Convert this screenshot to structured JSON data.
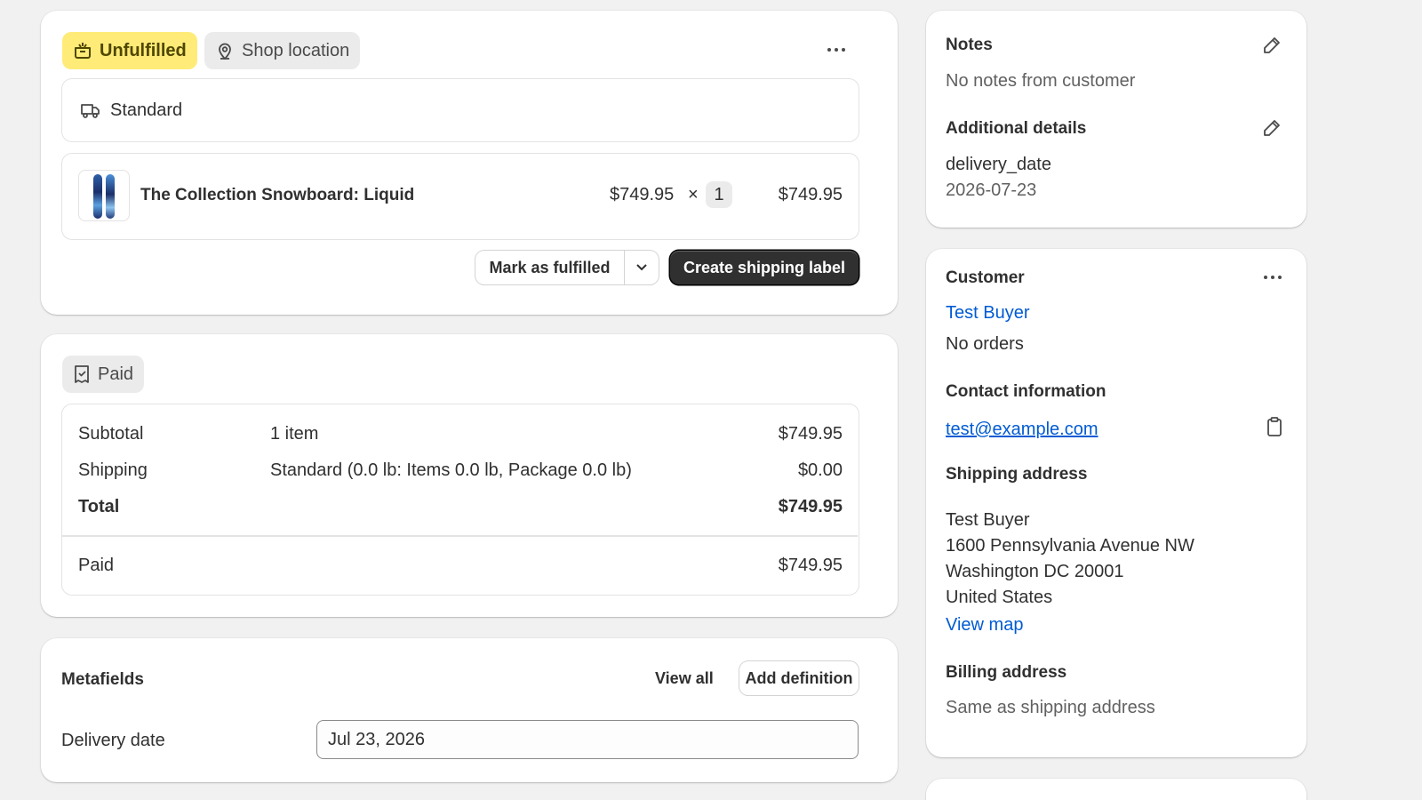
{
  "fulfillment": {
    "status_badge": "Unfulfilled",
    "location_badge": "Shop location",
    "shipping_method": "Standard",
    "line_item": {
      "title": "The Collection Snowboard: Liquid",
      "unit_price": "$749.95",
      "times": "×",
      "quantity": "1",
      "total": "$749.95"
    },
    "mark_fulfilled_label": "Mark as fulfilled",
    "create_label_button": "Create shipping label"
  },
  "payment": {
    "status_badge": "Paid",
    "rows": [
      {
        "label": "Subtotal",
        "desc": "1 item",
        "amount": "$749.95"
      },
      {
        "label": "Shipping",
        "desc": "Standard (0.0 lb: Items 0.0 lb, Package 0.0 lb)",
        "amount": "$0.00"
      },
      {
        "label": "Total",
        "desc": "",
        "amount": "$749.95"
      }
    ],
    "paid_label": "Paid",
    "paid_amount": "$749.95"
  },
  "metafields": {
    "title": "Metafields",
    "view_all": "View all",
    "add_definition": "Add definition",
    "field_label": "Delivery date",
    "field_value": "Jul 23, 2026"
  },
  "notes": {
    "title": "Notes",
    "text": "No notes from customer",
    "additional_title": "Additional details",
    "detail_key": "delivery_date",
    "detail_value": "2026-07-23"
  },
  "customer": {
    "title": "Customer",
    "name": "Test Buyer",
    "orders": "No orders",
    "contact_title": "Contact information",
    "email": "test@example.com",
    "shipping_title": "Shipping address",
    "address_lines": [
      "Test Buyer",
      "1600 Pennsylvania Avenue NW",
      "Washington DC 20001",
      "United States"
    ],
    "view_map": "View map",
    "billing_title": "Billing address",
    "billing_text": "Same as shipping address"
  },
  "colors": {
    "unfulfilled_badge_bg": "#ffeb78",
    "neutral_badge_bg": "#ebebeb",
    "link": "#005bd3",
    "primary_button": "#303030"
  }
}
